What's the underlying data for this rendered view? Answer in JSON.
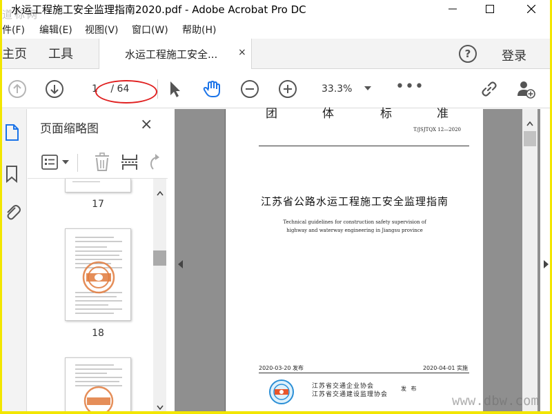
{
  "window": {
    "title": "水运工程施工安全监理指南2020.pdf - Adobe Acrobat Pro DC",
    "watermark_top": "道标网"
  },
  "menu": [
    "件(F)",
    "编辑(E)",
    "视图(V)",
    "窗口(W)",
    "帮助(H)"
  ],
  "tabs": {
    "home": "主页",
    "tools": "工具",
    "doc": "水运工程施工安全...",
    "close": "×",
    "help": "?",
    "login": "登录"
  },
  "toolbar": {
    "page_current": "1",
    "page_total": "/ 64",
    "zoom": "33.3%",
    "more": "•••"
  },
  "thumbnail_panel": {
    "title": "页面缩略图",
    "close": "×",
    "pages": [
      {
        "label": "17"
      },
      {
        "label": "18"
      },
      {
        "label": ""
      }
    ]
  },
  "document": {
    "header_chars": [
      "团",
      "体",
      "标",
      "准"
    ],
    "code": "T/JSJTQX 12—2020",
    "title": "江苏省公路水运工程施工安全监理指南",
    "subtitle_line1": "Technical guidelines for construction safety supervision of",
    "subtitle_line2": "highway and waterway engineering in Jiangsu province",
    "issue_date": "2020-03-20 发布",
    "effective_date": "2020-04-01 实施",
    "publisher1": "江苏省交通企业协会",
    "publisher2": "江苏省交通建设监理协会",
    "publish_word": "发 布"
  },
  "watermark_bottom": "www.dbw.com",
  "colors": {
    "frame": "#f2e600",
    "hand_tool": "#1a73e8",
    "annotation": "#e02020",
    "doc_background": "#8f8f8f"
  }
}
